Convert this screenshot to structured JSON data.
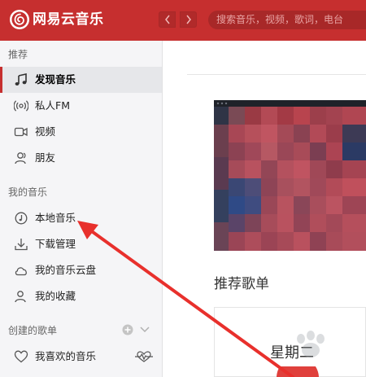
{
  "app": {
    "name": "网易云音乐"
  },
  "search": {
    "placeholder": "搜索音乐，视频，歌词，电台"
  },
  "sidebar": {
    "sections": [
      {
        "title": "推荐",
        "items": [
          {
            "label": "发现音乐",
            "icon": "music-note-icon",
            "active": true
          },
          {
            "label": "私人FM",
            "icon": "radio-icon"
          },
          {
            "label": "视频",
            "icon": "video-icon"
          },
          {
            "label": "朋友",
            "icon": "friends-icon"
          }
        ]
      },
      {
        "title": "我的音乐",
        "items": [
          {
            "label": "本地音乐",
            "icon": "clock-music-icon"
          },
          {
            "label": "下载管理",
            "icon": "download-icon"
          },
          {
            "label": "我的音乐云盘",
            "icon": "cloud-icon"
          },
          {
            "label": "我的收藏",
            "icon": "collection-icon"
          }
        ]
      },
      {
        "title": "创建的歌单",
        "items": [
          {
            "label": "我喜欢的音乐",
            "icon": "heart-icon"
          }
        ]
      }
    ]
  },
  "main": {
    "section_heading": "推荐歌单",
    "card_text": "星期二"
  },
  "colors": {
    "brand": "#c62f2f",
    "sidebar_bg": "#f5f5f7",
    "annotation_arrow": "#e8302c"
  }
}
